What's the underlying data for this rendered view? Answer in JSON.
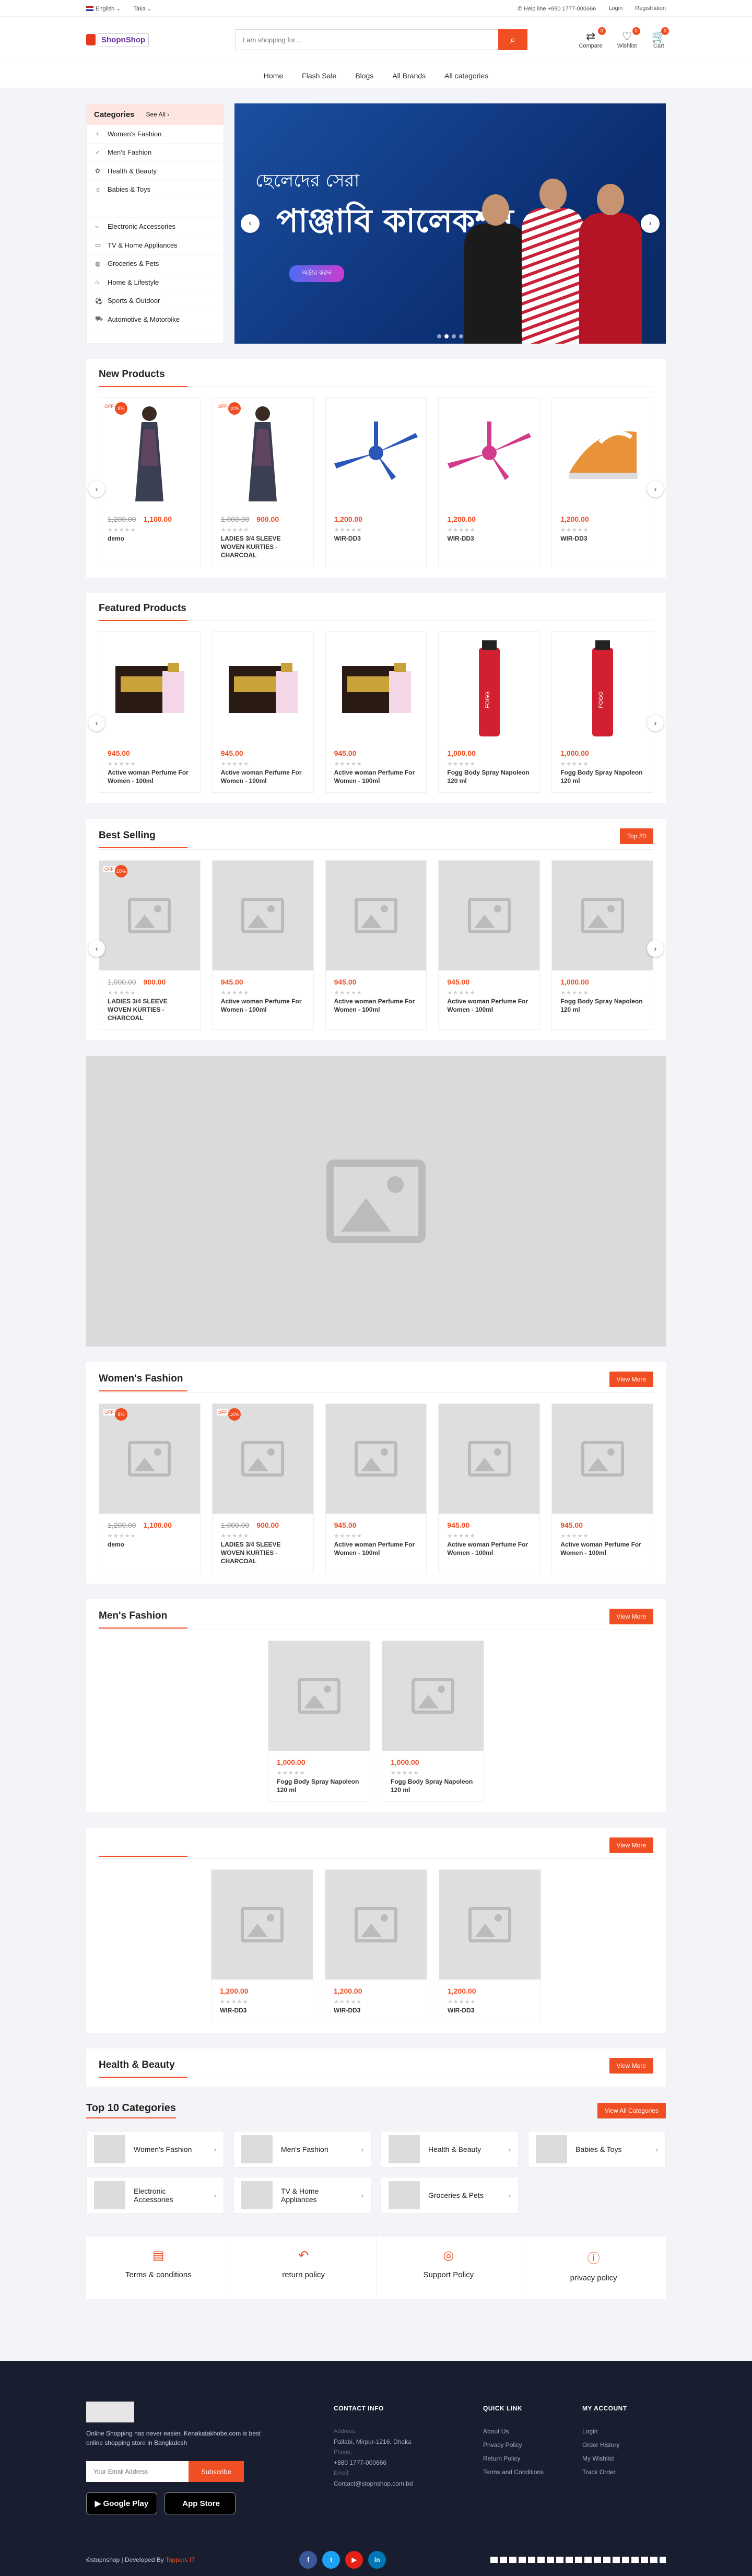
{
  "topbar": {
    "language": "English",
    "location": "Taka",
    "help": "Help line +880 1777-000666",
    "login": "Login",
    "registration": "Registration"
  },
  "header": {
    "logo": "ShopnShop",
    "search_placeholder": "I am shopping for...",
    "compare": "Compare",
    "compare_count": "0",
    "wishlist": "Wishlist",
    "wishlist_count": "0",
    "cart": "Cart",
    "cart_count": "0"
  },
  "nav": [
    "Home",
    "Flash Sale",
    "Blogs",
    "All Brands",
    "All categories"
  ],
  "categories": {
    "title": "Categories",
    "see_all": "See All",
    "items": [
      "Women's Fashion",
      "Men's Fashion",
      "Health & Beauty",
      "Babies & Toys",
      "",
      "Electronic Accessories",
      "TV & Home Appliances",
      "Groceries & Pets",
      "Home & Lifestyle",
      "Sports & Outdoor",
      "Automotive & Motorbike"
    ]
  },
  "banner": {
    "line1": "ছেলেদের সেরা",
    "line2": "পাঞ্জাবি কালেকশন",
    "button": "অর্ডার করুন"
  },
  "colors": {
    "accent": "#f04e23",
    "footer": "#181e30"
  },
  "new_products": {
    "title": "New Products",
    "items": [
      {
        "name": "demo",
        "price": "1,100.00",
        "old": "1,200.00",
        "off": "OFF",
        "pct": "8%",
        "img": "dress"
      },
      {
        "name": "LADIES 3/4 SLEEVE WOVEN KURTIES - CHARCOAL",
        "price": "900.00",
        "old": "1,000.00",
        "off": "OFF",
        "pct": "10%",
        "img": "dress"
      },
      {
        "name": "WIR-DD3",
        "price": "1,200.00",
        "old": "",
        "img": "fan-blue"
      },
      {
        "name": "WIR-DD3",
        "price": "1,200.00",
        "old": "",
        "img": "fan-pink"
      },
      {
        "name": "WIR-DD3",
        "price": "1,200.00",
        "old": "",
        "img": "iron"
      }
    ]
  },
  "featured": {
    "title": "Featured Products",
    "items": [
      {
        "name": "Active woman Perfume For Women - 100ml",
        "price": "945.00",
        "img": "perfume"
      },
      {
        "name": "Active woman Perfume For Women - 100ml",
        "price": "945.00",
        "img": "perfume"
      },
      {
        "name": "Active woman Perfume For Women - 100ml",
        "price": "945.00",
        "img": "perfume"
      },
      {
        "name": "Fogg Body Spray Napoleon 120 ml",
        "price": "1,000.00",
        "img": "spray"
      },
      {
        "name": "Fogg Body Spray Napoleon 120 ml",
        "price": "1,000.00",
        "img": "spray"
      }
    ]
  },
  "best_selling": {
    "title": "Best Selling",
    "button": "Top 20",
    "items": [
      {
        "name": "LADIES 3/4 SLEEVE WOVEN KURTIES - CHARCOAL",
        "price": "900.00",
        "old": "1,000.00",
        "off": "OFF",
        "pct": "10%"
      },
      {
        "name": "Active woman Perfume For Women - 100ml",
        "price": "945.00",
        "old": ""
      },
      {
        "name": "Active woman Perfume For Women - 100ml",
        "price": "945.00",
        "old": ""
      },
      {
        "name": "Active woman Perfume For Women - 100ml",
        "price": "945.00",
        "old": ""
      },
      {
        "name": "Fogg Body Spray Napoleon 120 ml",
        "price": "1,000.00",
        "old": ""
      }
    ]
  },
  "womens": {
    "title": "Women's Fashion",
    "button": "View More",
    "items": [
      {
        "name": "demo",
        "price": "1,100.00",
        "old": "1,200.00",
        "off": "OFF",
        "pct": "8%"
      },
      {
        "name": "LADIES 3/4 SLEEVE WOVEN KURTIES - CHARCOAL",
        "price": "900.00",
        "old": "1,000.00",
        "off": "OFF",
        "pct": "10%"
      },
      {
        "name": "Active woman Perfume For Women - 100ml",
        "price": "945.00",
        "old": ""
      },
      {
        "name": "Active woman Perfume For Women - 100ml",
        "price": "945.00",
        "old": ""
      },
      {
        "name": "Active woman Perfume For Women - 100ml",
        "price": "945.00",
        "old": ""
      }
    ]
  },
  "mens": {
    "title": "Men's Fashion",
    "button": "View More",
    "items": [
      {
        "name": "Fogg Body Spray Napoleon 120 ml",
        "price": "1,000.00",
        "old": ""
      },
      {
        "name": "Fogg Body Spray Napoleon 120 ml",
        "price": "1,000.00",
        "old": ""
      }
    ]
  },
  "unnamed": {
    "title": "",
    "button": "View More",
    "items": [
      {
        "name": "WIR-DD3",
        "price": "1,200.00",
        "old": ""
      },
      {
        "name": "WIR-DD3",
        "price": "1,200.00",
        "old": ""
      },
      {
        "name": "WIR-DD3",
        "price": "1,200.00",
        "old": ""
      }
    ]
  },
  "health": {
    "title": "Health & Beauty",
    "button": "View More"
  },
  "top_categories": {
    "title": "Top 10 Categories",
    "button": "View All Categories",
    "items": [
      "Women's Fashion",
      "Men's Fashion",
      "Health & Beauty",
      "Babies & Toys",
      "Electronic Accessories",
      "TV & Home Appliances",
      "Groceries & Pets"
    ]
  },
  "policies": [
    "Terms & conditions",
    "return policy",
    "Support Policy",
    "privacy policy"
  ],
  "footer": {
    "about": "Online Shopping has never easier. Kenakatakhobe.com is best online shopping store in Bangladesh",
    "email_placeholder": "Your Email Address",
    "subscribe": "Subscribe",
    "google_play": "Google Play",
    "app_store": "App Store",
    "contact_title": "CONTACT INFO",
    "address_label": "Address:",
    "address": "Pallabi, Mirpur-1216, Dhaka",
    "phone_label": "Phone:",
    "phone": "+880 1777-000666",
    "email_label": "Email:",
    "email": "Contact@stopnshop.com.bd",
    "quick_title": "QUICK LINK",
    "quick": [
      "About Us",
      "Privacy Policy",
      "Return Policy",
      "Terms and Conditions"
    ],
    "account_title": "MY ACCOUNT",
    "account": [
      "Login",
      "Order History",
      "My Wishlist",
      "Track Order"
    ],
    "copyright": "©stopnshop | Developed By",
    "developer": "Toppers IT"
  }
}
